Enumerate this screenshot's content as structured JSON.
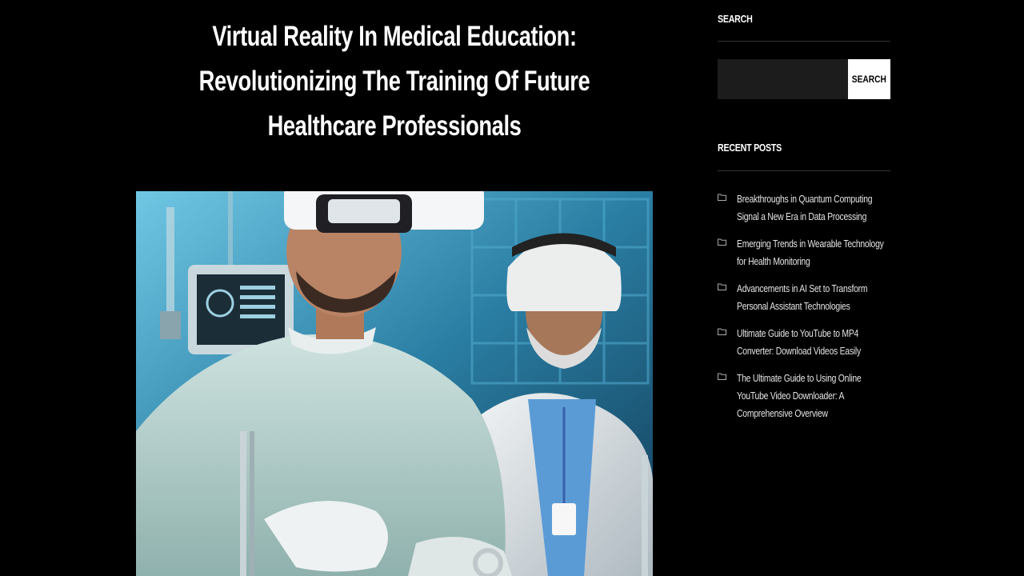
{
  "article": {
    "title": "Virtual Reality In Medical Education: Revolutionizing The Training Of Future Healthcare Professionals",
    "featured_image_alt": ""
  },
  "sidebar": {
    "search": {
      "title": "SEARCH",
      "input_value": "",
      "button_label": "SEARCH"
    },
    "recent_posts": {
      "title": "RECENT POSTS",
      "icon": "folder-icon",
      "items": [
        {
          "label": "Breakthroughs in Quantum Computing Signal a New Era in Data Processing"
        },
        {
          "label": "Emerging Trends in Wearable Technology for Health Monitoring"
        },
        {
          "label": "Advancements in AI Set to Transform Personal Assistant Technologies"
        },
        {
          "label": "Ultimate Guide to YouTube to MP4 Converter: Download Videos Easily"
        },
        {
          "label": "The Ultimate Guide to Using Online YouTube Video Downloader: A Comprehensive Overview"
        }
      ]
    }
  },
  "colors": {
    "background": "#000000",
    "text": "#ffffff",
    "link": "#e4e4e4",
    "divider": "#333333",
    "search_input_bg": "#1c1c1c",
    "search_button_bg": "#ffffff"
  }
}
